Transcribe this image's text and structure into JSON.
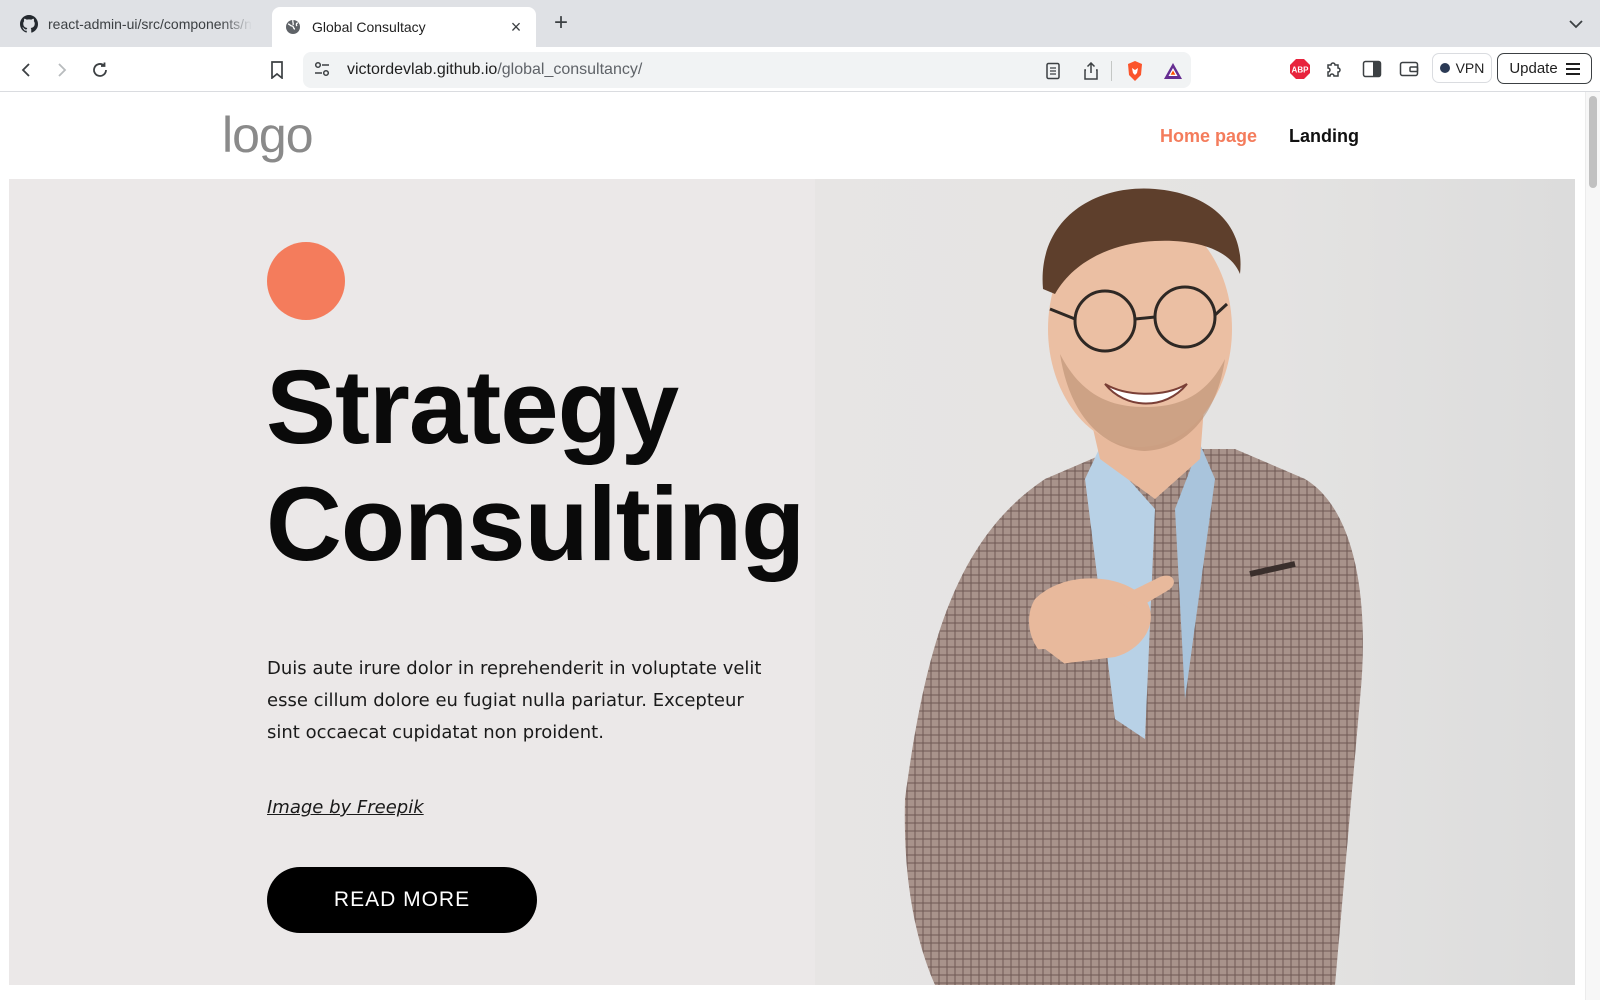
{
  "browser": {
    "tabs": [
      {
        "title": "react-admin-ui/src/components/na",
        "icon": "github-icon",
        "active": false
      },
      {
        "title": "Global Consultacy",
        "icon": "globe-icon",
        "active": true
      }
    ],
    "new_tab_label": "+",
    "close_tab_label": "×",
    "url_host": "victordevlab.github.io",
    "url_path": "/global_consultancy/",
    "vpn_label": "VPN",
    "update_label": "Update",
    "extension_abp_label": "ABP"
  },
  "site": {
    "logo": "logo",
    "nav": [
      {
        "label": "Home page",
        "active": true
      },
      {
        "label": "Landing",
        "active": false
      }
    ]
  },
  "hero": {
    "title_line1": "Strategy",
    "title_line2": "Consulting",
    "body": "Duis aute irure dolor in reprehenderit in voluptate velit esse cillum dolore eu fugiat nulla pariatur. Excepteur sint occaecat cupidatat non proident.",
    "credit": "Image by Freepik",
    "cta_label": "READ MORE"
  },
  "colors": {
    "accent": "#f47c5c",
    "hero_bg": "#ebe8e8",
    "button_bg": "#000000"
  }
}
